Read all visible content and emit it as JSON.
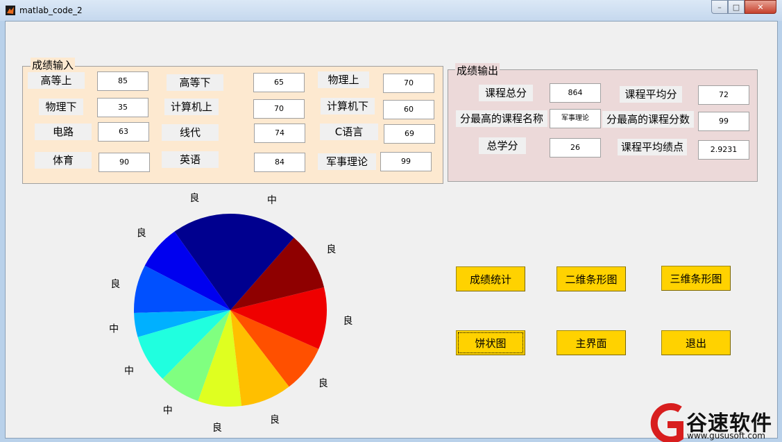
{
  "window": {
    "title": "matlab_code_2",
    "min": "–",
    "max": "□",
    "close": "✕"
  },
  "input_panel": {
    "title": "成绩输入",
    "fields": [
      {
        "label": "高等上",
        "value": "85"
      },
      {
        "label": "高等下",
        "value": "65"
      },
      {
        "label": "物理上",
        "value": "70"
      },
      {
        "label": "物理下",
        "value": "35"
      },
      {
        "label": "计算机上",
        "value": "70"
      },
      {
        "label": "计算机下",
        "value": "60"
      },
      {
        "label": "电路",
        "value": "63"
      },
      {
        "label": "线代",
        "value": "74"
      },
      {
        "label": "C语言",
        "value": "69"
      },
      {
        "label": "体育",
        "value": "90"
      },
      {
        "label": "英语",
        "value": "84"
      },
      {
        "label": "军事理论",
        "value": "99"
      }
    ]
  },
  "output_panel": {
    "title": "成绩输出",
    "fields": [
      {
        "label": "课程总分",
        "value": "864"
      },
      {
        "label": "课程平均分",
        "value": "72"
      },
      {
        "label": "分最高的课程名称",
        "value": "军事理论"
      },
      {
        "label": "分最高的课程分数",
        "value": "99"
      },
      {
        "label": "总学分",
        "value": "26"
      },
      {
        "label": "课程平均绩点",
        "value": "2.9231"
      }
    ]
  },
  "buttons": {
    "stats": "成绩统计",
    "bar2d": "二维条形图",
    "bar3d": "三维条形图",
    "pie": "饼状图",
    "main": "主界面",
    "exit": "退出"
  },
  "chart_data": {
    "type": "pie",
    "values": [
      85,
      65,
      70,
      35,
      70,
      60,
      63,
      74,
      69,
      90,
      84,
      99
    ],
    "labels": [
      "良",
      "良",
      "良",
      "中",
      "中",
      "中",
      "良",
      "良",
      "良",
      "良",
      "良",
      "中"
    ],
    "colors": [
      "#00008f",
      "#0000ef",
      "#0050ff",
      "#00b0ff",
      "#20ffdf",
      "#80ff80",
      "#dfff20",
      "#ffbf00",
      "#ff5000",
      "#ef0000",
      "#8f0000"
    ],
    "start": "top, counterclockwise"
  },
  "watermark": {
    "text": "谷速软件",
    "url": "www.gususoft.com"
  }
}
